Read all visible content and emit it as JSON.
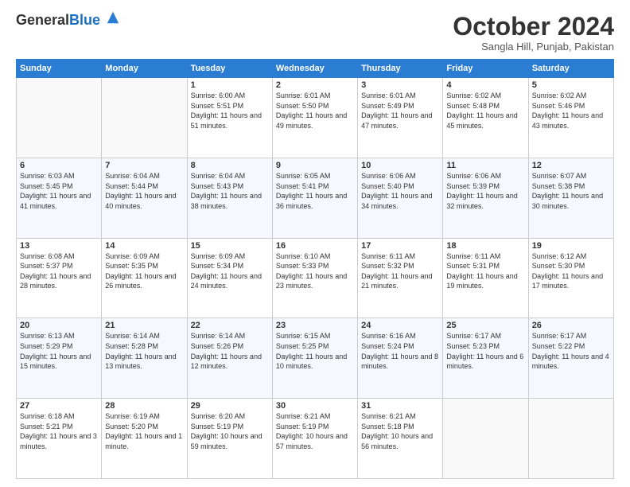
{
  "header": {
    "logo_general": "General",
    "logo_blue": "Blue",
    "month_title": "October 2024",
    "location": "Sangla Hill, Punjab, Pakistan"
  },
  "weekdays": [
    "Sunday",
    "Monday",
    "Tuesday",
    "Wednesday",
    "Thursday",
    "Friday",
    "Saturday"
  ],
  "weeks": [
    [
      {
        "day": "",
        "info": ""
      },
      {
        "day": "",
        "info": ""
      },
      {
        "day": "1",
        "info": "Sunrise: 6:00 AM\nSunset: 5:51 PM\nDaylight: 11 hours and 51 minutes."
      },
      {
        "day": "2",
        "info": "Sunrise: 6:01 AM\nSunset: 5:50 PM\nDaylight: 11 hours and 49 minutes."
      },
      {
        "day": "3",
        "info": "Sunrise: 6:01 AM\nSunset: 5:49 PM\nDaylight: 11 hours and 47 minutes."
      },
      {
        "day": "4",
        "info": "Sunrise: 6:02 AM\nSunset: 5:48 PM\nDaylight: 11 hours and 45 minutes."
      },
      {
        "day": "5",
        "info": "Sunrise: 6:02 AM\nSunset: 5:46 PM\nDaylight: 11 hours and 43 minutes."
      }
    ],
    [
      {
        "day": "6",
        "info": "Sunrise: 6:03 AM\nSunset: 5:45 PM\nDaylight: 11 hours and 41 minutes."
      },
      {
        "day": "7",
        "info": "Sunrise: 6:04 AM\nSunset: 5:44 PM\nDaylight: 11 hours and 40 minutes."
      },
      {
        "day": "8",
        "info": "Sunrise: 6:04 AM\nSunset: 5:43 PM\nDaylight: 11 hours and 38 minutes."
      },
      {
        "day": "9",
        "info": "Sunrise: 6:05 AM\nSunset: 5:41 PM\nDaylight: 11 hours and 36 minutes."
      },
      {
        "day": "10",
        "info": "Sunrise: 6:06 AM\nSunset: 5:40 PM\nDaylight: 11 hours and 34 minutes."
      },
      {
        "day": "11",
        "info": "Sunrise: 6:06 AM\nSunset: 5:39 PM\nDaylight: 11 hours and 32 minutes."
      },
      {
        "day": "12",
        "info": "Sunrise: 6:07 AM\nSunset: 5:38 PM\nDaylight: 11 hours and 30 minutes."
      }
    ],
    [
      {
        "day": "13",
        "info": "Sunrise: 6:08 AM\nSunset: 5:37 PM\nDaylight: 11 hours and 28 minutes."
      },
      {
        "day": "14",
        "info": "Sunrise: 6:09 AM\nSunset: 5:35 PM\nDaylight: 11 hours and 26 minutes."
      },
      {
        "day": "15",
        "info": "Sunrise: 6:09 AM\nSunset: 5:34 PM\nDaylight: 11 hours and 24 minutes."
      },
      {
        "day": "16",
        "info": "Sunrise: 6:10 AM\nSunset: 5:33 PM\nDaylight: 11 hours and 23 minutes."
      },
      {
        "day": "17",
        "info": "Sunrise: 6:11 AM\nSunset: 5:32 PM\nDaylight: 11 hours and 21 minutes."
      },
      {
        "day": "18",
        "info": "Sunrise: 6:11 AM\nSunset: 5:31 PM\nDaylight: 11 hours and 19 minutes."
      },
      {
        "day": "19",
        "info": "Sunrise: 6:12 AM\nSunset: 5:30 PM\nDaylight: 11 hours and 17 minutes."
      }
    ],
    [
      {
        "day": "20",
        "info": "Sunrise: 6:13 AM\nSunset: 5:29 PM\nDaylight: 11 hours and 15 minutes."
      },
      {
        "day": "21",
        "info": "Sunrise: 6:14 AM\nSunset: 5:28 PM\nDaylight: 11 hours and 13 minutes."
      },
      {
        "day": "22",
        "info": "Sunrise: 6:14 AM\nSunset: 5:26 PM\nDaylight: 11 hours and 12 minutes."
      },
      {
        "day": "23",
        "info": "Sunrise: 6:15 AM\nSunset: 5:25 PM\nDaylight: 11 hours and 10 minutes."
      },
      {
        "day": "24",
        "info": "Sunrise: 6:16 AM\nSunset: 5:24 PM\nDaylight: 11 hours and 8 minutes."
      },
      {
        "day": "25",
        "info": "Sunrise: 6:17 AM\nSunset: 5:23 PM\nDaylight: 11 hours and 6 minutes."
      },
      {
        "day": "26",
        "info": "Sunrise: 6:17 AM\nSunset: 5:22 PM\nDaylight: 11 hours and 4 minutes."
      }
    ],
    [
      {
        "day": "27",
        "info": "Sunrise: 6:18 AM\nSunset: 5:21 PM\nDaylight: 11 hours and 3 minutes."
      },
      {
        "day": "28",
        "info": "Sunrise: 6:19 AM\nSunset: 5:20 PM\nDaylight: 11 hours and 1 minute."
      },
      {
        "day": "29",
        "info": "Sunrise: 6:20 AM\nSunset: 5:19 PM\nDaylight: 10 hours and 59 minutes."
      },
      {
        "day": "30",
        "info": "Sunrise: 6:21 AM\nSunset: 5:19 PM\nDaylight: 10 hours and 57 minutes."
      },
      {
        "day": "31",
        "info": "Sunrise: 6:21 AM\nSunset: 5:18 PM\nDaylight: 10 hours and 56 minutes."
      },
      {
        "day": "",
        "info": ""
      },
      {
        "day": "",
        "info": ""
      }
    ]
  ]
}
